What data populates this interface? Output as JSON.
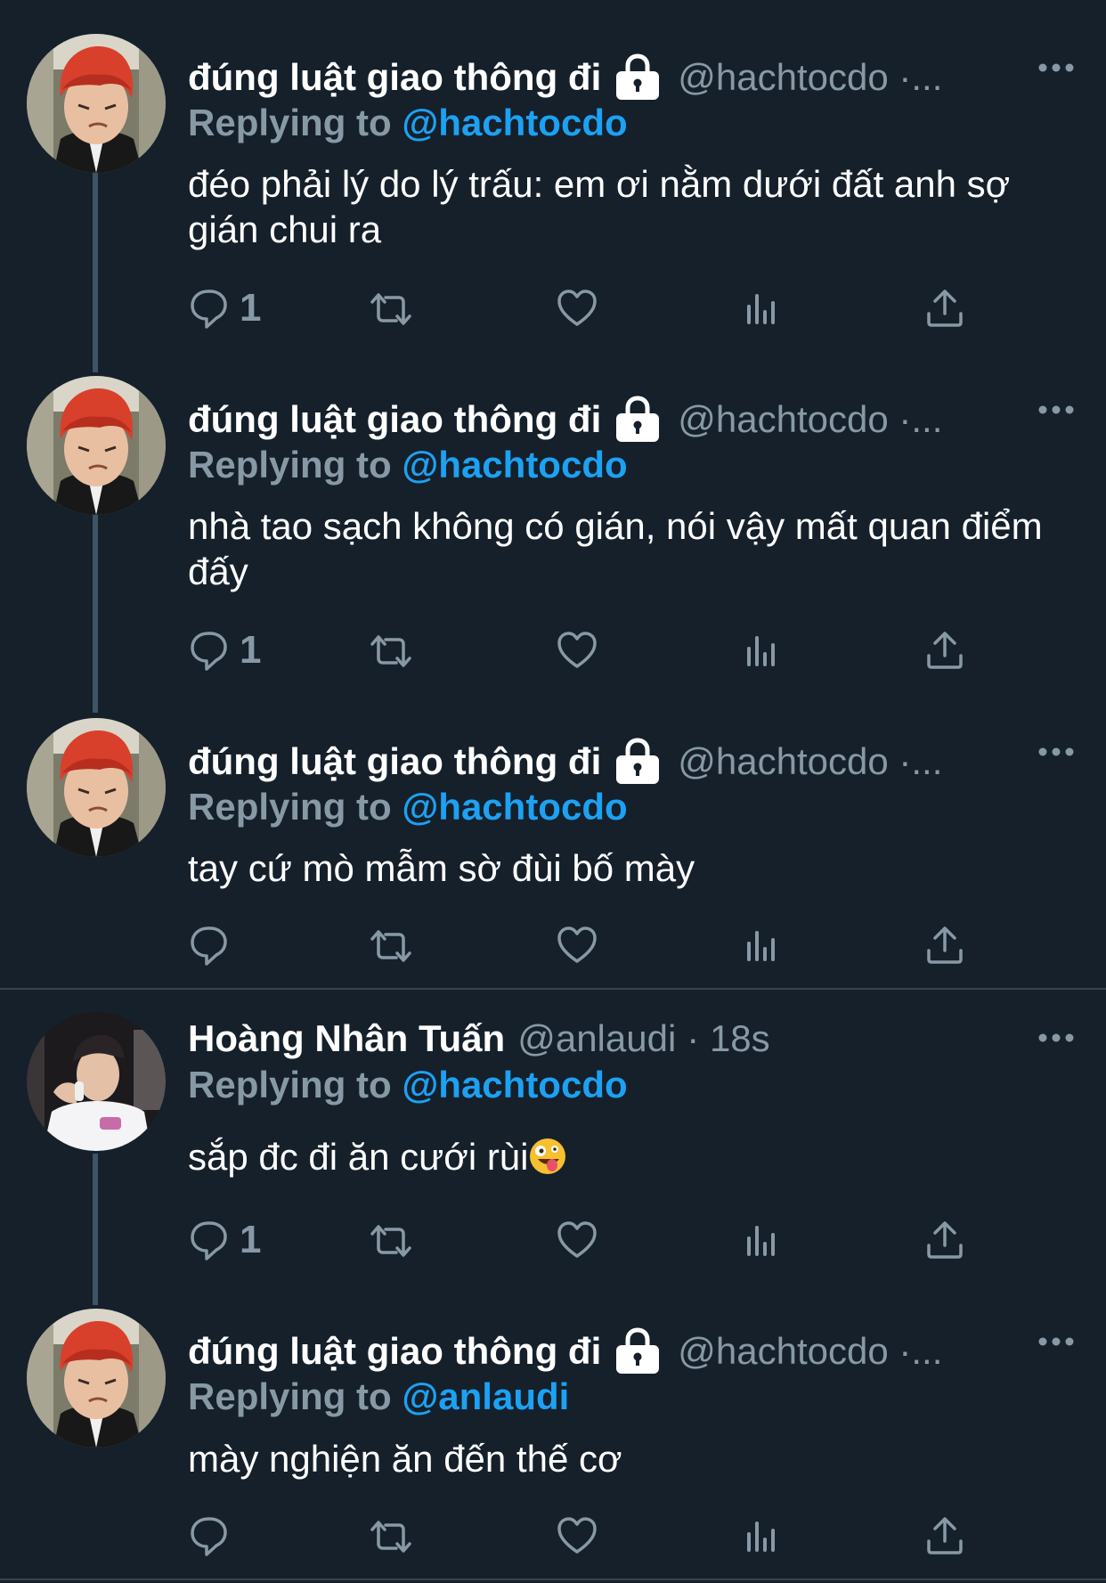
{
  "tweets": [
    {
      "display_name": "đúng luật giao thông đi",
      "handle": "@hachtocdo ·...",
      "protected": true,
      "replying_label": "Replying to",
      "replying_to": "@hachtocdo",
      "text": "đéo phải lý do lý trấu: em ơi nằm dưới đất anh sợ gián chui ra",
      "reply_count": "1",
      "avatar": "red-hair-avatar"
    },
    {
      "display_name": "đúng luật giao thông đi",
      "handle": "@hachtocdo ·...",
      "protected": true,
      "replying_label": "Replying to",
      "replying_to": "@hachtocdo",
      "text": "nhà tao sạch không có gián, nói vậy mất quan điểm đấy",
      "reply_count": "1",
      "avatar": "red-hair-avatar"
    },
    {
      "display_name": "đúng luật giao thông đi",
      "handle": "@hachtocdo ·...",
      "protected": true,
      "replying_label": "Replying to",
      "replying_to": "@hachtocdo",
      "text": "tay cứ mò mẫm sờ đùi bố mày",
      "reply_count": "",
      "avatar": "red-hair-avatar"
    },
    {
      "display_name": "Hoàng Nhân Tuấn",
      "handle": "@anlaudi",
      "time": "· 18s",
      "protected": false,
      "replying_label": "Replying to",
      "replying_to": "@hachtocdo",
      "text": "sắp đc đi ăn cưới rùi",
      "emoji": "zany-face-emoji",
      "reply_count": "1",
      "avatar": "cap-photo-avatar"
    },
    {
      "display_name": "đúng luật giao thông đi",
      "handle": "@hachtocdo ·...",
      "protected": true,
      "replying_label": "Replying to",
      "replying_to": "@anlaudi",
      "text": "mày nghiện ăn đến thế cơ",
      "reply_count": "",
      "avatar": "red-hair-avatar"
    }
  ],
  "icons": {
    "reply": "reply-icon",
    "retweet": "retweet-icon",
    "like": "heart-icon",
    "analytics": "analytics-icon",
    "share": "share-icon",
    "more": "more-icon",
    "lock": "lock-icon"
  },
  "colors": {
    "background": "#15202b",
    "secondary_text": "#8899a6",
    "mention": "#1da1f2",
    "thread_line": "#3d5466",
    "divider": "#38444d"
  }
}
